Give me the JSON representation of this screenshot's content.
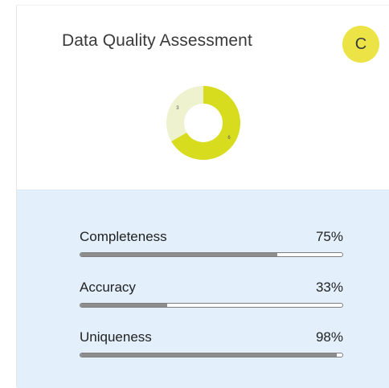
{
  "card": {
    "title": "Data Quality Assessment",
    "grade": "C",
    "grade_color": "#ece446"
  },
  "chart_data": {
    "type": "pie",
    "style": "donut",
    "slices": [
      {
        "value": 6,
        "label": "6",
        "color": "#d8dc1f"
      },
      {
        "value": 3,
        "label": "3",
        "color": "#eef2cf"
      }
    ]
  },
  "metrics": [
    {
      "label": "Completeness",
      "value_text": "75%",
      "fraction": 0.75
    },
    {
      "label": "Accuracy",
      "value_text": "33%",
      "fraction": 0.33
    },
    {
      "label": "Uniqueness",
      "value_text": "98%",
      "fraction": 0.98
    }
  ]
}
